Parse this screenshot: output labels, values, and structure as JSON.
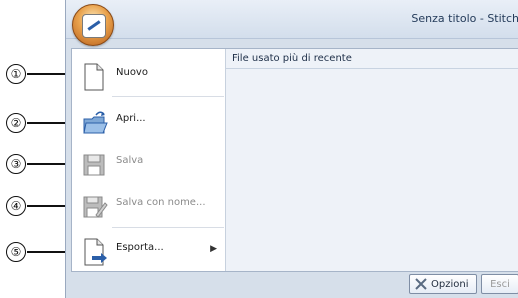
{
  "callouts": [
    "①",
    "②",
    "③",
    "④",
    "⑤"
  ],
  "window": {
    "title": "Senza titolo - Stitch"
  },
  "menu": {
    "items": [
      {
        "label": "Nuovo",
        "disabled": false,
        "icon": "new-document-icon"
      },
      {
        "label": "Apri...",
        "disabled": false,
        "icon": "open-folder-icon"
      },
      {
        "label": "Salva",
        "disabled": true,
        "icon": "floppy-disk-icon"
      },
      {
        "label": "Salva con nome...",
        "disabled": true,
        "icon": "save-as-icon"
      },
      {
        "label": "Esporta...",
        "disabled": false,
        "icon": "export-icon",
        "has_submenu": true
      }
    ],
    "recent_title": "File usato più di recente"
  },
  "footer": {
    "options_label": "Opzioni",
    "exit_label": "Esci"
  },
  "colors": {
    "accent_blue": "#2b5fa8",
    "window_bg": "#d6dfea"
  }
}
